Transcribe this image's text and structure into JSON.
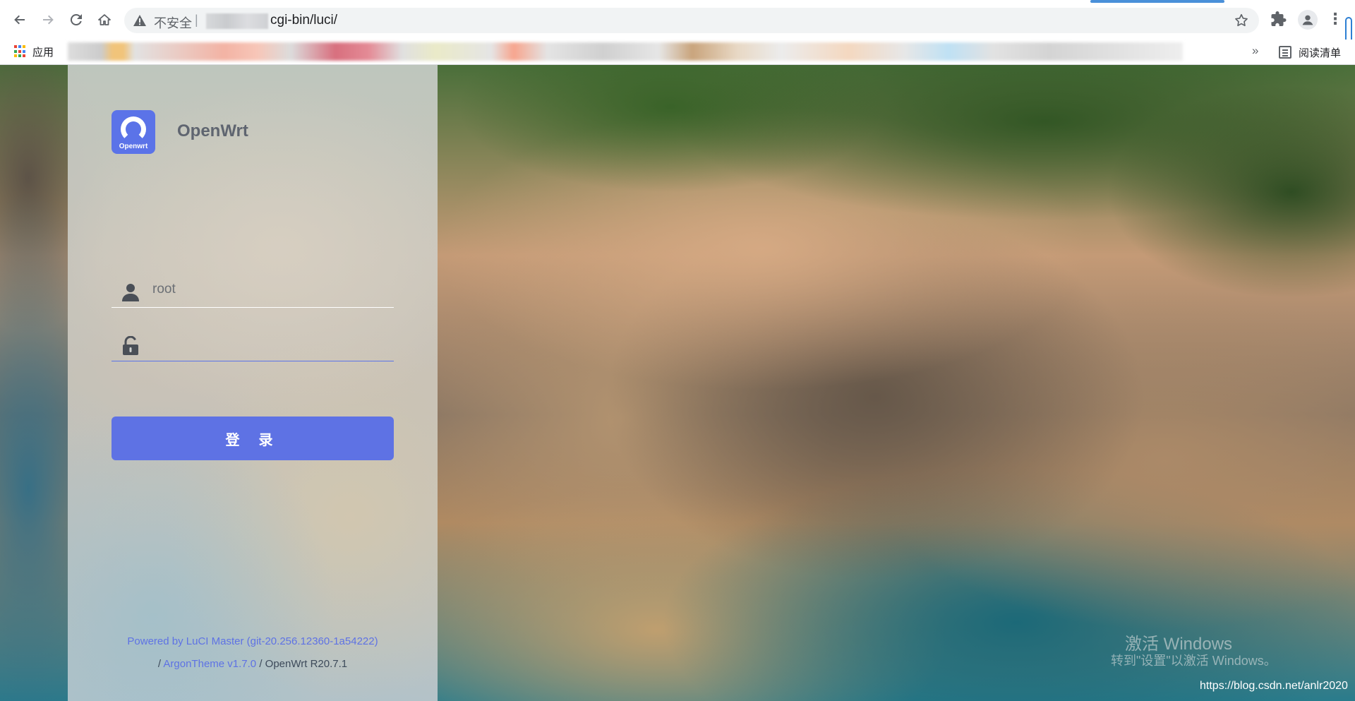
{
  "browser": {
    "security_label": "不安全",
    "url_separator": "|",
    "url_visible": "cgi-bin/luci/",
    "bookmarks": {
      "apps_label": "应用",
      "overflow_label": "»",
      "reading_list_label": "阅读清单"
    }
  },
  "login": {
    "brand_name": "OpenWrt",
    "logo_text": "Openwrt",
    "username_value": "root",
    "password_value": "",
    "login_button_label": "登 录"
  },
  "footer": {
    "powered_link": "Powered by LuCI Master (git-20.256.12360-1a54222)",
    "sep1": "/ ",
    "theme_link": "ArgonTheme v1.7.0",
    "version_text": " / OpenWrt R20.7.1"
  },
  "overlay": {
    "activate_title": "激活 Windows",
    "activate_hint": "转到\"设置\"以激活 Windows。",
    "csdn_watermark": "https://blog.csdn.net/anlr2020"
  },
  "colors": {
    "accent": "#5e72e4",
    "logo_bg": "#5b73e8"
  }
}
